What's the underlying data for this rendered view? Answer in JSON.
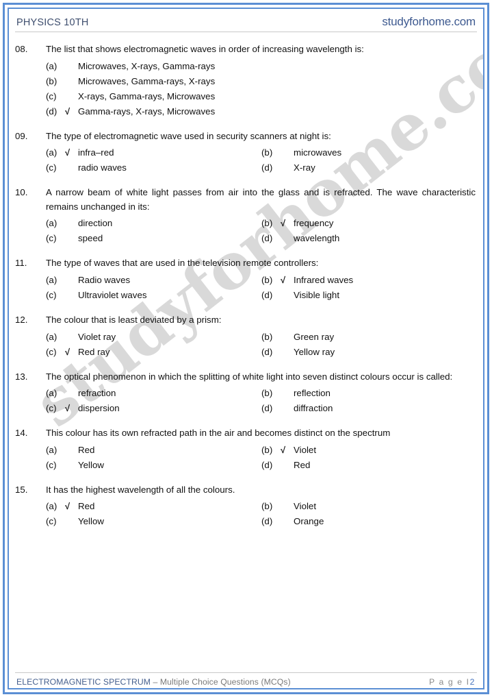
{
  "header": {
    "title": "PHYSICS 10TH",
    "site": "studyforhome.com"
  },
  "watermark": {
    "text": "studyforhome.com"
  },
  "colors": {
    "border_blue": "#5B8FD4",
    "header_title": "#3E4E6E",
    "header_site": "#3E5A90",
    "footer_topic": "#46608E",
    "footer_sub": "#7a7a7a",
    "page_number": "#4674BE",
    "watermark": "#d9d9d9"
  },
  "tick": "√",
  "questions": [
    {
      "number": "08.",
      "text": "The list that shows electromagnetic waves in order of increasing wavelength is:",
      "layout": "stack",
      "options": [
        {
          "label": "(a)",
          "text": "Microwaves, X-rays, Gamma-rays",
          "correct": false
        },
        {
          "label": "(b)",
          "text": "Microwaves, Gamma-rays, X-rays",
          "correct": false
        },
        {
          "label": "(c)",
          "text": "X-rays, Gamma-rays, Microwaves",
          "correct": false
        },
        {
          "label": "(d)",
          "text": "Gamma-rays, X-rays, Microwaves",
          "correct": true
        }
      ]
    },
    {
      "number": "09.",
      "text": "The type of electromagnetic wave used in security scanners at night is:",
      "layout": "grid",
      "options": [
        {
          "label": "(a)",
          "text": "infra–red",
          "correct": true
        },
        {
          "label": "(b)",
          "text": "microwaves",
          "correct": false
        },
        {
          "label": "(c)",
          "text": "radio waves",
          "correct": false
        },
        {
          "label": "(d)",
          "text": "X-ray",
          "correct": false
        }
      ]
    },
    {
      "number": "10.",
      "text": "A narrow beam of white light passes from air into the glass and is refracted. The wave characteristic remains unchanged in its:",
      "layout": "grid",
      "options": [
        {
          "label": "(a)",
          "text": "direction",
          "correct": false
        },
        {
          "label": "(b)",
          "text": "frequency",
          "correct": true
        },
        {
          "label": "(c)",
          "text": "speed",
          "correct": false
        },
        {
          "label": "(d)",
          "text": "wavelength",
          "correct": false
        }
      ]
    },
    {
      "number": "11.",
      "text": "The type of waves that are used in the television remote controllers:",
      "layout": "grid",
      "options": [
        {
          "label": "(a)",
          "text": "Radio waves",
          "correct": false
        },
        {
          "label": "(b)",
          "text": "Infrared waves",
          "correct": true
        },
        {
          "label": "(c)",
          "text": "Ultraviolet waves",
          "correct": false
        },
        {
          "label": "(d)",
          "text": "Visible light",
          "correct": false
        }
      ]
    },
    {
      "number": "12.",
      "text": "The colour that is least deviated by a prism:",
      "layout": "grid",
      "options": [
        {
          "label": "(a)",
          "text": "Violet ray",
          "correct": false
        },
        {
          "label": "(b)",
          "text": "Green ray",
          "correct": false
        },
        {
          "label": "(c)",
          "text": "Red ray",
          "correct": true
        },
        {
          "label": "(d)",
          "text": "Yellow ray",
          "correct": false
        }
      ]
    },
    {
      "number": "13.",
      "text": "The optical phenomenon in which the splitting of white light into seven distinct colours occur is called:",
      "layout": "grid",
      "options": [
        {
          "label": "(a)",
          "text": "refraction",
          "correct": false
        },
        {
          "label": "(b)",
          "text": "reflection",
          "correct": false
        },
        {
          "label": "(c)",
          "text": "dispersion",
          "correct": true
        },
        {
          "label": "(d)",
          "text": "diffraction",
          "correct": false
        }
      ]
    },
    {
      "number": "14.",
      "text": "This colour has its own refracted path in the air and becomes distinct on the spectrum",
      "layout": "grid",
      "options": [
        {
          "label": "(a)",
          "text": "Red",
          "correct": false
        },
        {
          "label": "(b)",
          "text": "Violet",
          "correct": true
        },
        {
          "label": "(c)",
          "text": "Yellow",
          "correct": false
        },
        {
          "label": "(d)",
          "text": "Red",
          "correct": false
        }
      ]
    },
    {
      "number": "15.",
      "text": "It has the highest wavelength of all the colours.",
      "layout": "grid",
      "options": [
        {
          "label": "(a)",
          "text": "Red",
          "correct": true
        },
        {
          "label": "(b)",
          "text": "Violet",
          "correct": false
        },
        {
          "label": "(c)",
          "text": "Yellow",
          "correct": false
        },
        {
          "label": "(d)",
          "text": "Orange",
          "correct": false
        }
      ]
    }
  ],
  "footer": {
    "topic": "ELECTROMAGNETIC SPECTRUM",
    "subtitle": " – Multiple Choice Questions (MCQs)",
    "page_label": "P a g e  I",
    "page_number": "2"
  }
}
